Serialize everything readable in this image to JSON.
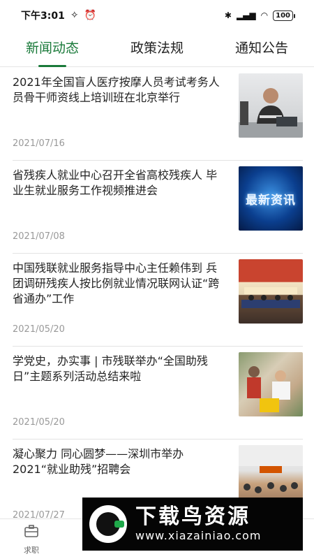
{
  "status_bar": {
    "time": "下午3:01",
    "battery": "100"
  },
  "tabs": [
    {
      "label": "新闻动态",
      "active": true
    },
    {
      "label": "政策法规",
      "active": false
    },
    {
      "label": "通知公告",
      "active": false
    }
  ],
  "news": [
    {
      "title": "2021年全国盲人医疗按摩人员考试考务人员骨干师资线上培训班在北京举行",
      "date": "2021/07/16"
    },
    {
      "title": "省残疾人就业中心召开全省高校残疾人 毕业生就业服务工作视频推进会",
      "date": "2021/07/08",
      "thumb_text": "最新资讯"
    },
    {
      "title": "中国残联就业服务指导中心主任赖伟到 兵团调研残疾人按比例就业情况联网认证“跨省通办”工作",
      "date": "2021/05/20"
    },
    {
      "title": "学党史，办实事 | 市残联举办“全国助残日”主题系列活动总结来啦",
      "date": "2021/05/20"
    },
    {
      "title": "凝心聚力 同心圆梦——深圳市举办2021“就业助残”招聘会",
      "date": "2021/07/27"
    }
  ],
  "bottom_nav": {
    "item_label": "求职"
  },
  "watermark": {
    "name": "下载鸟资源",
    "url": "www.xiazainiao.com"
  },
  "colors": {
    "accent": "#1a7a3a"
  }
}
